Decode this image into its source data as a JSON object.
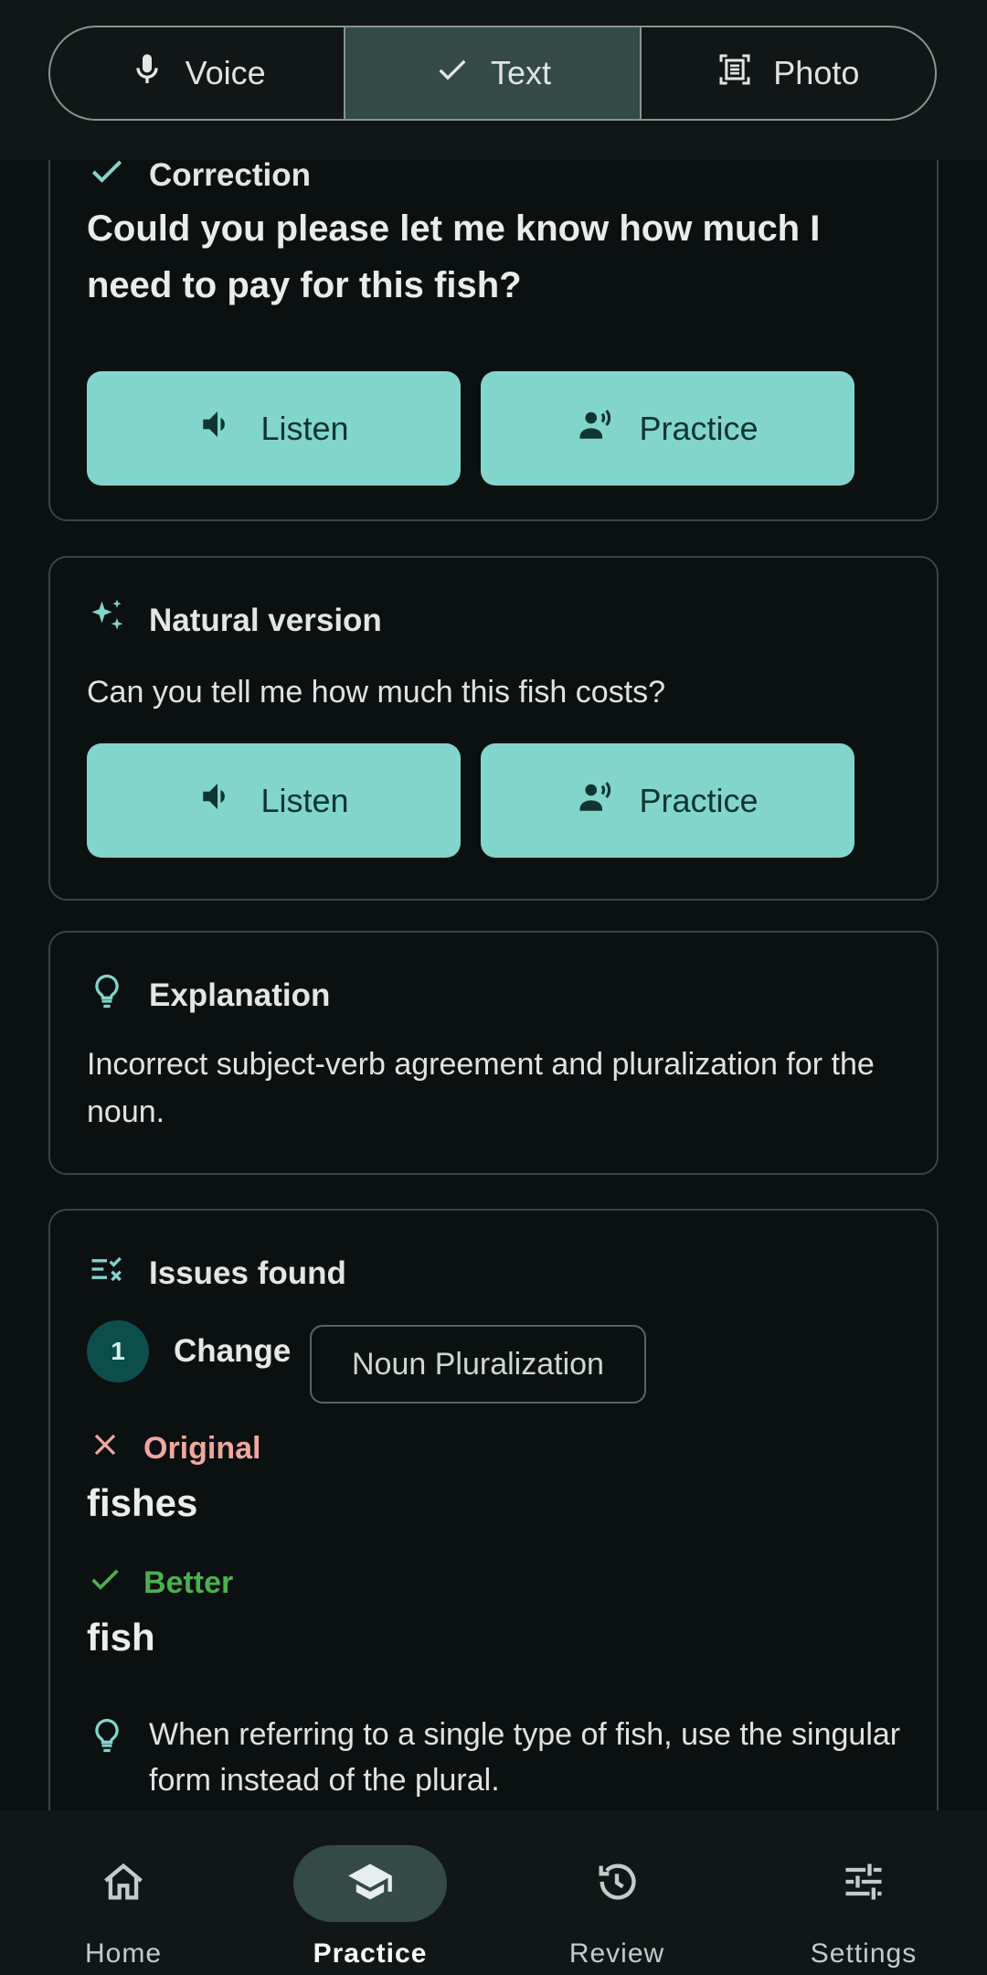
{
  "mode_selector": {
    "voice": "Voice",
    "text": "Text",
    "photo": "Photo",
    "active": "Text"
  },
  "correction": {
    "title": "Correction",
    "text": "Could you please let me know how much I need to pay for this fish?",
    "listen": "Listen",
    "practice": "Practice"
  },
  "natural": {
    "title": "Natural version",
    "text": "Can you tell me how much this fish costs?",
    "listen": "Listen",
    "practice": "Practice"
  },
  "explanation": {
    "title": "Explanation",
    "text": "Incorrect subject-verb agreement and pluralization for the noun."
  },
  "issues": {
    "title": "Issues found",
    "items": [
      {
        "number": "1",
        "type_label": "Change",
        "category": "Noun Pluralization",
        "original_label": "Original",
        "original": "fishes",
        "better_label": "Better",
        "better": "fish",
        "tip": "When referring to a single type of fish, use the singular form instead of the plural."
      }
    ]
  },
  "bottom_nav": {
    "home": "Home",
    "practice": "Practice",
    "review": "Review",
    "settings": "Settings",
    "active": "Practice"
  },
  "colors": {
    "accent": "#82d5cc",
    "active_surface": "#334a47",
    "error": "#f0a79f",
    "success": "#4caf50"
  }
}
